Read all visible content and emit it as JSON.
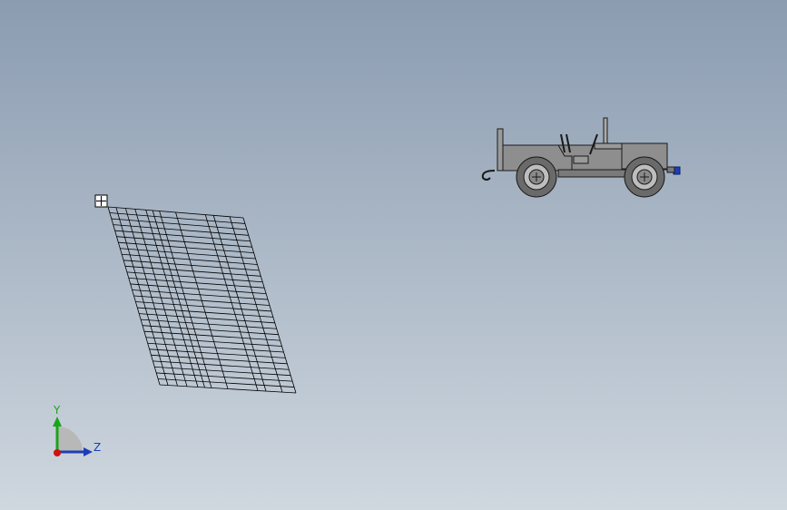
{
  "viewport": {
    "background_top": "#8b9cb1",
    "background_bottom": "#cfd7df"
  },
  "objects": [
    {
      "name": "bom-table",
      "type": "table-drawing",
      "style": "wireframe",
      "row_count": 30,
      "color": "#000000"
    },
    {
      "name": "jeep-model",
      "type": "vehicle",
      "view": "side",
      "body_color": "#8c8c8c",
      "accent_color": "#1d3fb5"
    }
  ],
  "triad": {
    "icon": "coordinate-triad-icon",
    "y_axis": {
      "label": "Y",
      "color": "#1aa51a"
    },
    "z_axis": {
      "label": "Z",
      "color": "#1d3fb5"
    },
    "x_axis": {
      "label": "",
      "color": "#d01010"
    }
  },
  "handle": {
    "icon": "move-handle-icon"
  }
}
